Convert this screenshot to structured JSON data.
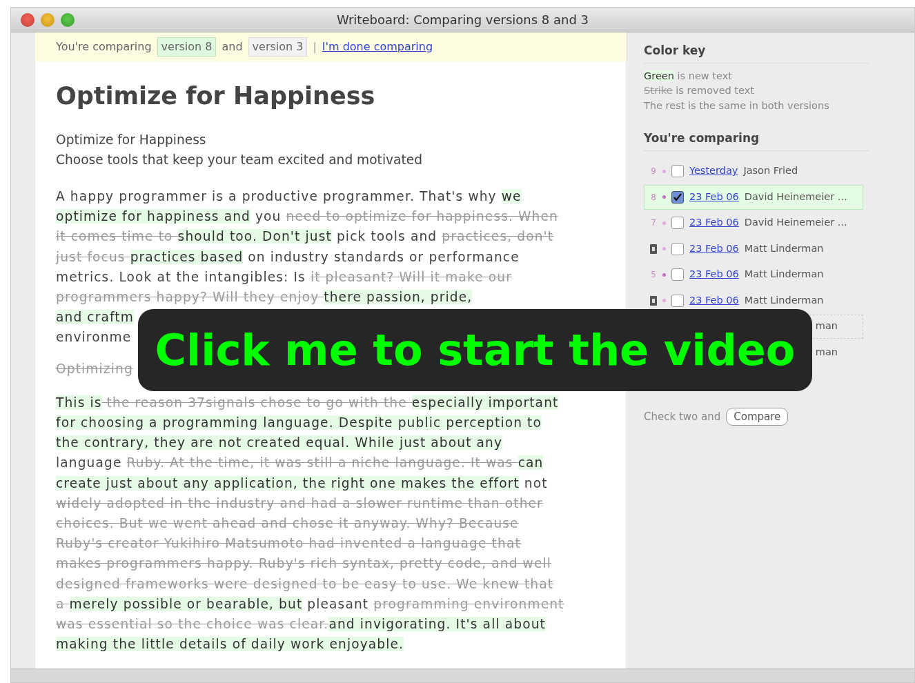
{
  "window": {
    "title": "Writeboard: Comparing versions 8 and 3"
  },
  "compare_bar": {
    "label": "You're comparing",
    "versions": [
      {
        "text": "version 8",
        "kind": "new"
      },
      {
        "text": "version 3",
        "kind": "old"
      }
    ],
    "joiner": "and",
    "separator": "|",
    "done_link": "I'm done comparing"
  },
  "document": {
    "title": "Optimize for Happiness",
    "intro_lines": [
      "Optimize for Happiness",
      "Choose tools that keep your team excited and motivated"
    ],
    "paragraphs": [
      {
        "segments": [
          {
            "kind": "same",
            "text": "A happy programmer is a productive programmer. That's why "
          },
          {
            "kind": "added",
            "text": "we optimize for happiness and"
          },
          {
            "kind": "same",
            "text": " you "
          },
          {
            "kind": "removed",
            "text": "need to optimize for happiness. When it comes time to "
          },
          {
            "kind": "added",
            "text": "should too. Don't just"
          },
          {
            "kind": "same",
            "text": " pick tools and "
          },
          {
            "kind": "removed",
            "text": "practices, don't just focus "
          },
          {
            "kind": "added",
            "text": "practices based"
          },
          {
            "kind": "same",
            "text": " on industry standards or performance metrics. Look at the intangibles: Is "
          },
          {
            "kind": "removed",
            "text": "it pleasant? Will it make our programmers happy? Will they enjoy "
          },
          {
            "kind": "added",
            "text": "there passion, pride,"
          }
        ],
        "partial_lines": [
          {
            "kind": "added",
            "text": "and craftm"
          },
          {
            "kind": "same",
            "text": "environme"
          }
        ]
      },
      {
        "segments": [
          {
            "kind": "removed",
            "text": "Optimizing"
          }
        ]
      },
      {
        "segments": [
          {
            "kind": "added",
            "text": "This is"
          },
          {
            "kind": "removed",
            "text": " the reason 37signals chose to go with the "
          },
          {
            "kind": "added",
            "text": "especially important for choosing a programming language. Despite public perception to the contrary, they are not created equal. While just about any"
          },
          {
            "kind": "same",
            "text": " language "
          },
          {
            "kind": "removed",
            "text": "Ruby. At the time, it was still a niche language. It was "
          },
          {
            "kind": "added",
            "text": "can create just about any application, the right one makes the effort"
          },
          {
            "kind": "same",
            "text": " not "
          },
          {
            "kind": "removed",
            "text": "widely adopted in the industry and had a slower runtime than other choices. But we went ahead and chose it anyway. Why? Because Ruby's creator Yukihiro Matsumoto had invented a language that makes programmers happy. Ruby's rich syntax, pretty code, and well designed frameworks were designed to be easy to use. We knew that a "
          },
          {
            "kind": "added",
            "text": "merely possible or bearable, but"
          },
          {
            "kind": "same",
            "text": " pleasant "
          },
          {
            "kind": "removed",
            "text": "programming environment was essential so the choice was clear."
          },
          {
            "kind": "added",
            "text": "and invigorating. It's all about making the little details of daily work enjoyable."
          }
        ]
      }
    ]
  },
  "sidebar": {
    "color_key": {
      "heading": "Color key",
      "lines": [
        [
          {
            "kind": "added",
            "text": "Green"
          },
          {
            "kind": "same",
            "text": " is new text"
          }
        ],
        [
          {
            "kind": "removed",
            "text": "Strike"
          },
          {
            "kind": "same",
            "text": " is removed text"
          }
        ],
        [
          {
            "kind": "same",
            "text": "The rest is the same in both versions"
          }
        ]
      ]
    },
    "versions": {
      "heading": "You're comparing",
      "rows": [
        {
          "kind": "number",
          "number": "9",
          "color": "#e0a8dc",
          "checked": false,
          "selected": false,
          "outlined": false,
          "date": "Yesterday",
          "author": "Jason Fried"
        },
        {
          "kind": "number",
          "number": "8",
          "color": "#c070c0",
          "checked": true,
          "selected": true,
          "outlined": false,
          "date": "23 Feb 06",
          "author": "David Heinemeier ..."
        },
        {
          "kind": "number",
          "number": "7",
          "color": "#e0a8dc",
          "checked": false,
          "selected": false,
          "outlined": false,
          "date": "23 Feb 06",
          "author": "David Heinemeier ..."
        },
        {
          "kind": "icon",
          "color": "#e0a8dc",
          "checked": false,
          "selected": false,
          "outlined": false,
          "date": "23 Feb 06",
          "author": "Matt Linderman"
        },
        {
          "kind": "number",
          "number": "5",
          "color": "#c070c0",
          "checked": false,
          "selected": false,
          "outlined": false,
          "date": "23 Feb 06",
          "author": "Matt Linderman"
        },
        {
          "kind": "icon",
          "color": "#e0a8dc",
          "checked": false,
          "selected": false,
          "outlined": false,
          "date": "23 Feb 06",
          "author": "Matt Linderman"
        },
        {
          "kind": "covered",
          "selected": false,
          "outlined": true,
          "tail": "man"
        },
        {
          "kind": "covered",
          "selected": false,
          "outlined": false,
          "tail": "man"
        }
      ],
      "hint": "Check two and",
      "compare_button": "Compare"
    }
  },
  "video_overlay": {
    "text": "Click me to start the video"
  }
}
